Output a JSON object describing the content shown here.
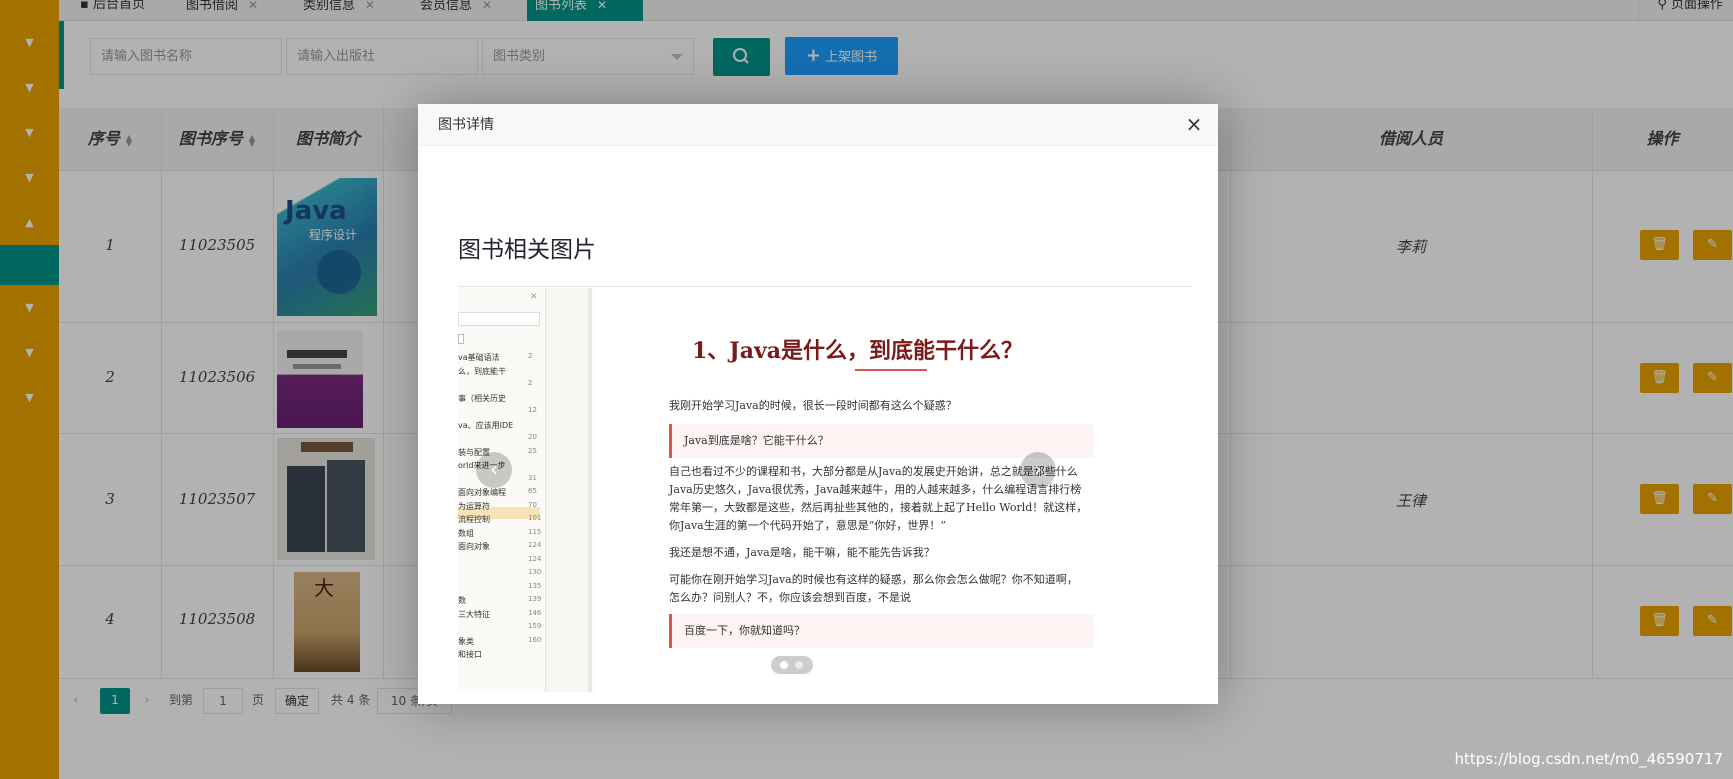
{
  "tabs": [
    {
      "icon": "home-icon",
      "label": "后台首页",
      "closable": false
    },
    {
      "label": "图书借阅",
      "closable": true
    },
    {
      "label": "类别信息",
      "closable": true
    },
    {
      "label": "会员信息",
      "closable": true
    },
    {
      "label": "图书列表",
      "closable": true,
      "active": true
    }
  ],
  "close_glyph": "✕",
  "page_ops_label": "页面操作",
  "search": {
    "name_placeholder": "请输入图书名称",
    "publisher_placeholder": "请输入出版社",
    "category_placeholder": "图书类别",
    "add_button": "上架图书"
  },
  "table": {
    "columns": [
      "序号",
      "图书序号",
      "图书简介",
      "借阅人员",
      "操作"
    ],
    "rows": [
      {
        "index": "1",
        "book_no": "11023505",
        "borrower": "李莉"
      },
      {
        "index": "2",
        "book_no": "11023506",
        "borrower": ""
      },
      {
        "index": "3",
        "book_no": "11023507",
        "borrower": "王律"
      },
      {
        "index": "4",
        "book_no": "11023508",
        "borrower": ""
      }
    ]
  },
  "pager": {
    "current": "1",
    "goto_label": "到第",
    "page_input": "1",
    "page_unit": "页",
    "confirm": "确定",
    "total": "共 4 条",
    "page_size": "10 条/页"
  },
  "modal": {
    "title": "图书详情",
    "heading": "图书相关图片",
    "doc_title": "1、Java是什么，到底能干什么？",
    "doc_para1": "我刚开始学习Java的时候，很长一段时间都有这么个疑惑？",
    "doc_quote1": "Java到底是啥？它能干什么？",
    "doc_para2_l1": "自己也看过不少的课程和书，大部分都是从Java的发展史开始讲，总之就是那些什么",
    "doc_para2_l2": "Java历史悠久，Java很优秀，Java越来越牛，用的人越来越多，什么编程语言排行榜",
    "doc_para2_l3": "常年第一，大致都是这些，然后再扯些其他的，接着就上起了Hello World！就这样，",
    "doc_para2_l4": "你Java生涯的第一个代码开始了，意思是“你好，世界！”",
    "doc_para3": "我还是想不通，Java是啥，能干嘛，能不能先告诉我？",
    "doc_para4_l1": "可能你在刚开始学习Java的时候也有这样的疑惑，那么你会怎么做呢？你不知道啊，",
    "doc_para4_l2": "怎么办？问别人？不，你应该会想到百度，不是说",
    "doc_quote2": "百度一下，你就知道吗？",
    "toc": [
      {
        "text": "va基础语法",
        "num": "2"
      },
      {
        "text": "么，到底能干",
        "num": ""
      },
      {
        "text": "",
        "num": "2"
      },
      {
        "text": "事（相关历史",
        "num": ""
      },
      {
        "text": "",
        "num": "12"
      },
      {
        "text": "va、应该用IDE",
        "num": ""
      },
      {
        "text": "",
        "num": "20"
      },
      {
        "text": "装与配置",
        "num": "25"
      },
      {
        "text": "orld来进一步",
        "num": ""
      },
      {
        "text": "",
        "num": "31"
      },
      {
        "text": "面向对象编程",
        "num": "65"
      },
      {
        "text": "为运算符",
        "num": "70"
      },
      {
        "text": "流程控制",
        "num": "101"
      },
      {
        "text": "数组",
        "num": "115"
      },
      {
        "text": "面向对象",
        "num": "124"
      },
      {
        "text": "",
        "num": "124"
      },
      {
        "text": "",
        "num": "130"
      },
      {
        "text": "",
        "num": "135"
      },
      {
        "text": "数",
        "num": "139"
      },
      {
        "text": "三大特征",
        "num": "146"
      },
      {
        "text": "",
        "num": "159"
      },
      {
        "text": "象类",
        "num": "160"
      },
      {
        "text": "和接口",
        "num": ""
      }
    ]
  },
  "watermark": "https://blog.csdn.net/m0_46590717",
  "colors": {
    "accent": "#009688",
    "sidebar": "#e8a200",
    "blue": "#1e9fff",
    "op_button": "#e8a200"
  }
}
